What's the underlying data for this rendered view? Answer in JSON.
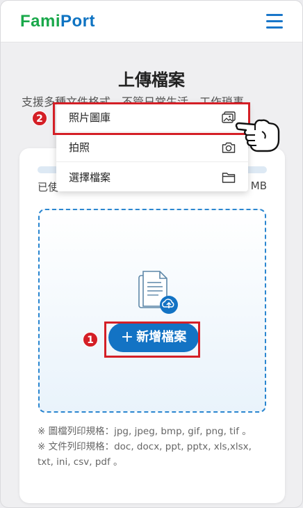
{
  "header": {
    "logo_fami": "Fami",
    "logo_port": "Port",
    "menu_icon": "hamburger-menu-icon"
  },
  "page": {
    "title": "上傳檔案",
    "subtitle": "支援多種文件格式，不管日常生活、工作瑣事,"
  },
  "usage": {
    "progress": 0,
    "left_label": "已使",
    "right_label": "MB"
  },
  "upload": {
    "add_button_label": "新增檔案",
    "add_button_icon": "plus-icon",
    "files_icon": "documents-upload-icon"
  },
  "notes": {
    "image_formats": "※ 圖檔列印規格：jpg, jpeg, bmp, gif, png, tif 。",
    "doc_formats": "※ 文件列印規格：doc, docx, ppt, pptx, xls,xlsx, txt, ini, csv, pdf 。"
  },
  "dropdown": {
    "items": [
      {
        "label": "照片圖庫",
        "icon": "photo-gallery-icon"
      },
      {
        "label": "拍照",
        "icon": "camera-icon"
      },
      {
        "label": "選擇檔案",
        "icon": "folder-icon"
      }
    ]
  },
  "annotations": {
    "step1": "1",
    "step2": "2",
    "highlight_color": "#d41f26"
  },
  "colors": {
    "brand_green": "#19a84a",
    "brand_blue": "#0e73c2",
    "button_blue": "#1373c4"
  }
}
